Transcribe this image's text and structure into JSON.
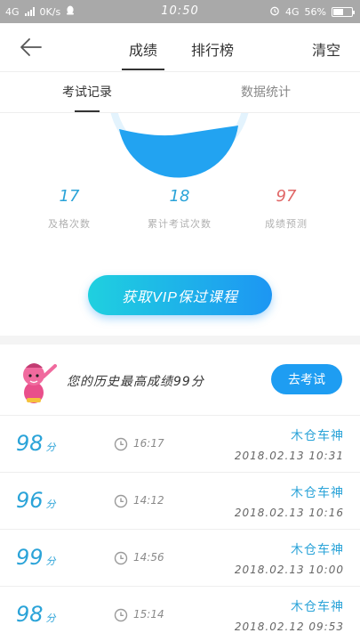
{
  "status_bar": {
    "net_left": "4G",
    "speed": "0K/s",
    "time": "10:50",
    "net_right": "4G",
    "battery": "56%",
    "battery_level": 0.56
  },
  "header": {
    "tabs": [
      {
        "label": "成绩",
        "active": true
      },
      {
        "label": "排行榜",
        "active": false
      }
    ],
    "clear_label": "清空"
  },
  "sub_tabs": [
    {
      "label": "考试记录",
      "active": true
    },
    {
      "label": "数据统计",
      "active": false
    }
  ],
  "stats": [
    {
      "value": "17",
      "label": "及格次数",
      "color": "#2aa3d8"
    },
    {
      "value": "18",
      "label": "累计考试次数",
      "color": "#2aa3d8"
    },
    {
      "value": "97",
      "label": "成绩预测",
      "color": "#e06666"
    }
  ],
  "vip_button": "获取VIP保过课程",
  "best": {
    "text": "您的历史最高成绩99分",
    "button": "去考试"
  },
  "records": [
    {
      "score": "98",
      "unit": "分",
      "duration": "16:17",
      "name": "木仓车神",
      "date": "2018.02.13  10:31"
    },
    {
      "score": "96",
      "unit": "分",
      "duration": "14:12",
      "name": "木仓车神",
      "date": "2018.02.13  10:16"
    },
    {
      "score": "99",
      "unit": "分",
      "duration": "14:56",
      "name": "木仓车神",
      "date": "2018.02.13  10:00"
    },
    {
      "score": "98",
      "unit": "分",
      "duration": "15:14",
      "name": "木仓车神",
      "date": "2018.02.12  09:53"
    }
  ],
  "colors": {
    "accent": "#1e9df2",
    "gauge_fill": "#22a3f1",
    "gauge_ring": "#e3f3fd",
    "record_blue": "#2aa3d8"
  }
}
